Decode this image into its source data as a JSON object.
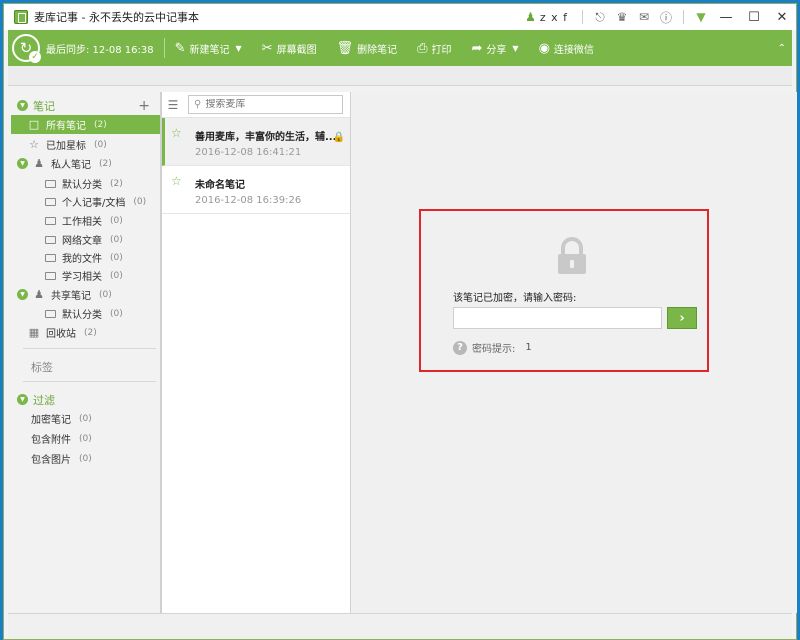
{
  "window": {
    "title": "麦库记事 - 永不丢失的云中记事本",
    "user": "z x f"
  },
  "toolbar": {
    "sync_text": "最后同步: 12-08 16:38",
    "new_note": "新建笔记",
    "screenshot": "屏幕截图",
    "delete_note": "删除笔记",
    "print": "打印",
    "share": "分享",
    "wechat": "连接微信"
  },
  "sidebar": {
    "notes_header": "笔记",
    "all_notes": {
      "label": "所有笔记",
      "count": "(2)"
    },
    "starred": {
      "label": "已加星标",
      "count": "(0)"
    },
    "private_notes": {
      "label": "私人笔记",
      "count": "(2)"
    },
    "folders": [
      {
        "label": "默认分类",
        "count": "(2)"
      },
      {
        "label": "个人记事/文档",
        "count": "(0)"
      },
      {
        "label": "工作相关",
        "count": "(0)"
      },
      {
        "label": "网络文章",
        "count": "(0)"
      },
      {
        "label": "我的文件",
        "count": "(0)"
      },
      {
        "label": "学习相关",
        "count": "(0)"
      }
    ],
    "shared_notes": {
      "label": "共享笔记",
      "count": "(0)"
    },
    "shared_folders": [
      {
        "label": "默认分类",
        "count": "(0)"
      }
    ],
    "trash": {
      "label": "回收站",
      "count": "(2)"
    },
    "tags_header": "标签",
    "filter_header": "过滤",
    "filters": [
      {
        "label": "加密笔记",
        "count": "(0)"
      },
      {
        "label": "包含附件",
        "count": "(0)"
      },
      {
        "label": "包含图片",
        "count": "(0)"
      }
    ]
  },
  "notelist": {
    "search_placeholder": "搜索麦库",
    "notes": [
      {
        "title": "善用麦库，丰富你的生活，辅...",
        "date": "2016-12-08 16:41:21",
        "locked": true
      },
      {
        "title": "未命名笔记",
        "date": "2016-12-08 16:39:26",
        "locked": false
      }
    ]
  },
  "lock": {
    "prompt": "该笔记已加密，请输入密码:",
    "password_value": "",
    "hint_label": "密码提示:",
    "hint_value": "1"
  },
  "colors": {
    "accent": "#7ab648",
    "highlight_border": "#e0262b"
  }
}
